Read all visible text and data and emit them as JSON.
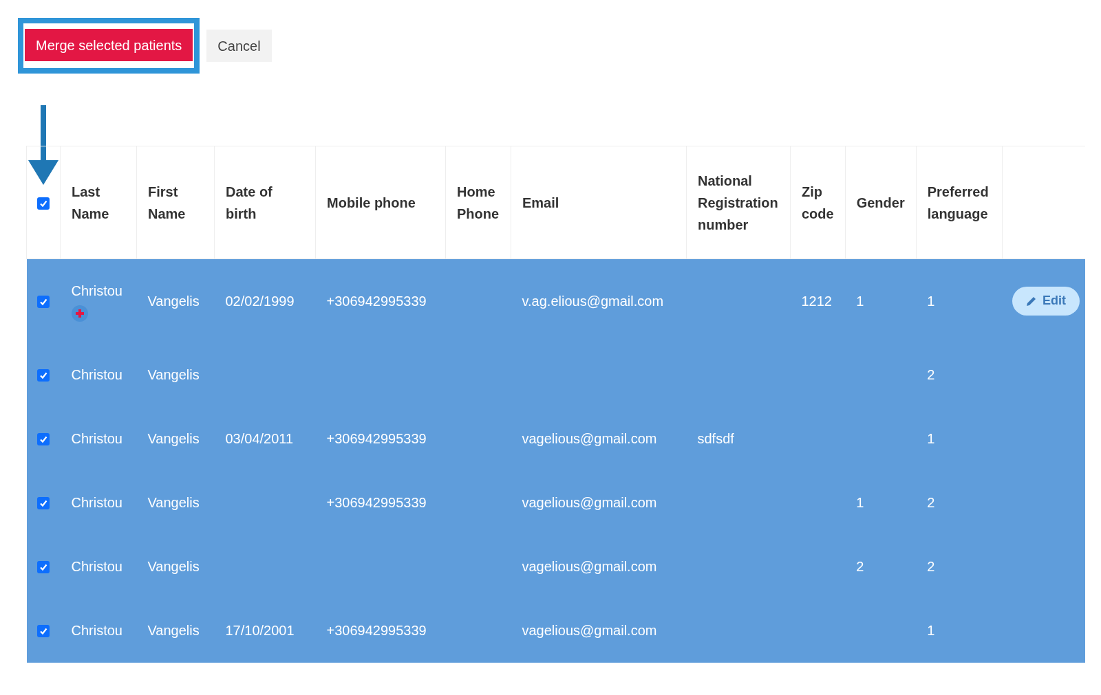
{
  "actions": {
    "merge_button": "Merge selected patients",
    "cancel_button": "Cancel"
  },
  "table": {
    "select_all_checked": true,
    "columns": [
      "Last Name",
      "First Name",
      "Date of birth",
      "Mobile phone",
      "Home Phone",
      "Email",
      "National Registration number",
      "Zip code",
      "Gender",
      "Preferred language"
    ],
    "rows": [
      {
        "selected": true,
        "checked": true,
        "primary": true,
        "cells": [
          "Christou",
          "Vangelis",
          "02/02/1999",
          "+306942995339",
          "",
          "v.ag.elious@gmail.com",
          "",
          "1212",
          "1",
          "1"
        ],
        "edit_button": "Edit"
      },
      {
        "selected": true,
        "checked": true,
        "primary": false,
        "cells": [
          "Christou",
          "Vangelis",
          "",
          "",
          "",
          "",
          "",
          "",
          "",
          "2"
        ]
      },
      {
        "selected": true,
        "checked": true,
        "primary": false,
        "cells": [
          "Christou",
          "Vangelis",
          "03/04/2011",
          "+306942995339",
          "",
          "vagelious@gmail.com",
          "sdfsdf",
          "",
          "",
          "1"
        ]
      },
      {
        "selected": true,
        "checked": true,
        "primary": false,
        "cells": [
          "Christou",
          "Vangelis",
          "",
          "+306942995339",
          "",
          "vagelious@gmail.com",
          "",
          "",
          "1",
          "2"
        ]
      },
      {
        "selected": true,
        "checked": true,
        "primary": false,
        "cells": [
          "Christou",
          "Vangelis",
          "",
          "",
          "",
          "vagelious@gmail.com",
          "",
          "",
          "2",
          "2"
        ]
      },
      {
        "selected": true,
        "checked": true,
        "primary": false,
        "cells": [
          "Christou",
          "Vangelis",
          "17/10/2001",
          "+306942995339",
          "",
          "vagelious@gmail.com",
          "",
          "",
          "",
          "1"
        ]
      }
    ]
  }
}
